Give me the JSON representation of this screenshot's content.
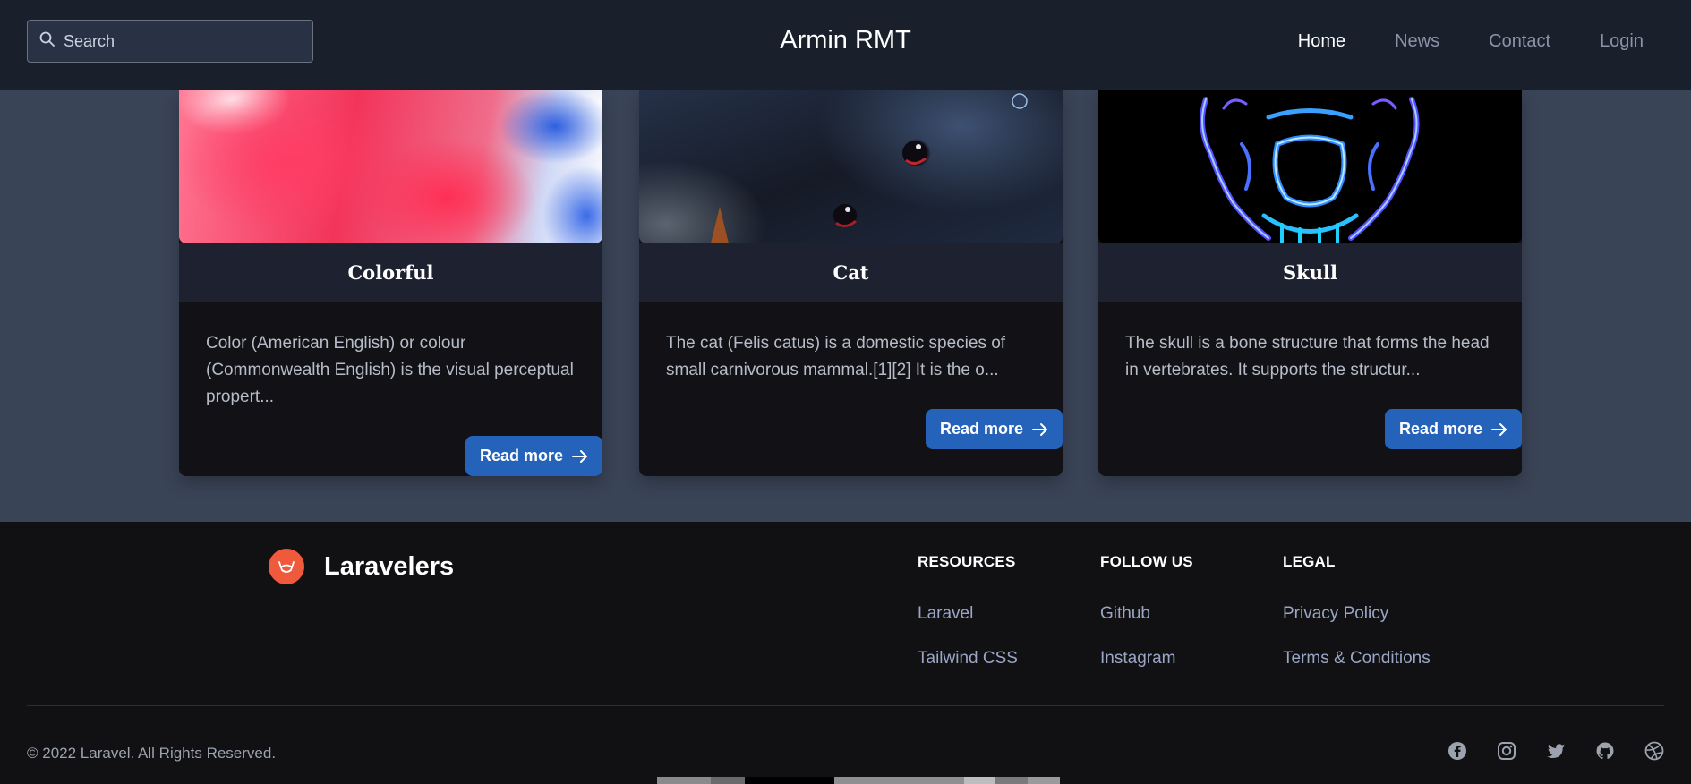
{
  "header": {
    "search_placeholder": "Search",
    "brand": "Armin RMT",
    "nav": [
      {
        "label": "Home",
        "active": true
      },
      {
        "label": "News",
        "active": false
      },
      {
        "label": "Contact",
        "active": false
      },
      {
        "label": "Login",
        "active": false
      }
    ]
  },
  "cards": [
    {
      "title": "Colorful",
      "description": "Color (American English) or colour (Commonwealth English) is the visual perceptual propert...",
      "button": "Read more",
      "image": "colorful-smoke"
    },
    {
      "title": "Cat",
      "description": "The cat (Felis catus) is a domestic species of small carnivorous mammal.[1][2] It is the o...",
      "button": "Read more",
      "image": "black-cat"
    },
    {
      "title": "Skull",
      "description": "The skull is a bone structure that forms the head in vertebrates. It supports the structur...",
      "button": "Read more",
      "image": "neon-skull"
    }
  ],
  "footer": {
    "logo_text": "Laravelers",
    "columns": [
      {
        "heading": "RESOURCES",
        "links": [
          "Laravel",
          "Tailwind CSS"
        ]
      },
      {
        "heading": "FOLLOW US",
        "links": [
          "Github",
          "Instagram"
        ]
      },
      {
        "heading": "LEGAL",
        "links": [
          "Privacy Policy",
          "Terms & Conditions"
        ]
      }
    ],
    "copyright": "© 2022 Laravel. All Rights Reserved.",
    "social_icons": [
      "facebook-icon",
      "instagram-icon",
      "twitter-icon",
      "github-icon",
      "dribbble-icon"
    ]
  },
  "colors": {
    "header_bg": "#1a1f2c",
    "main_bg": "#3a4457",
    "footer_bg": "#111114",
    "button_bg": "#2563bb",
    "logo_accent": "#f05a3c",
    "link_color": "#9aa6c4"
  }
}
